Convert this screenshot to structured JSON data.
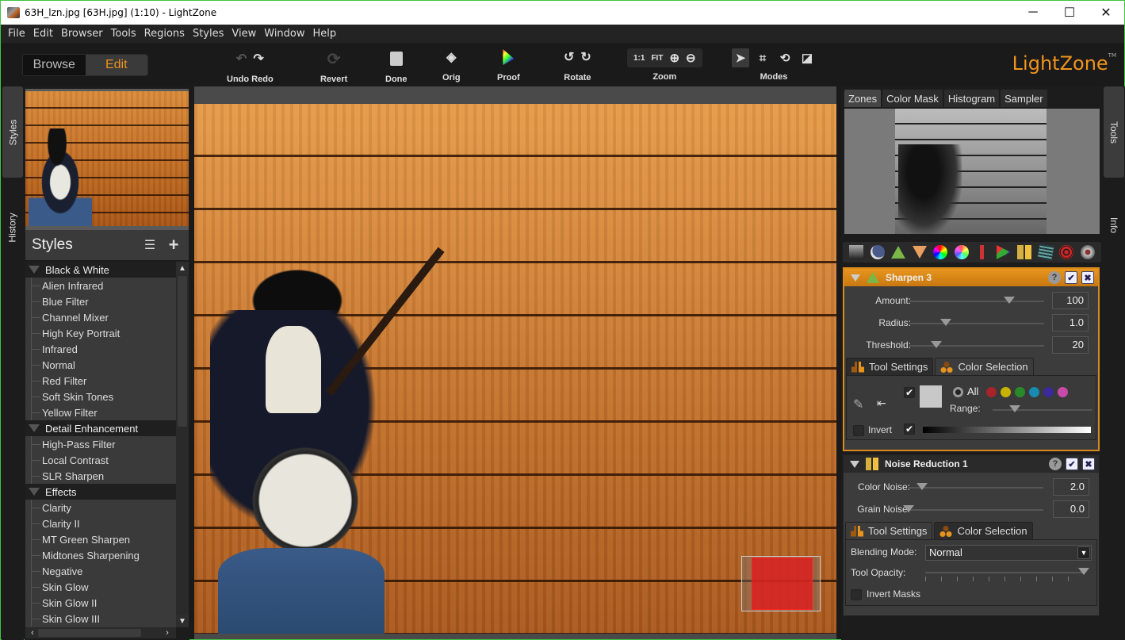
{
  "window": {
    "title": "63H_lzn.jpg [63H.jpg] (1:10) - LightZone",
    "controls": {
      "minimize": "─",
      "maximize": "☐",
      "close": "✕"
    }
  },
  "menu": [
    "File",
    "Edit",
    "Browser",
    "Tools",
    "Regions",
    "Styles",
    "View",
    "Window",
    "Help"
  ],
  "toolbar": {
    "mode_browse": "Browse",
    "mode_edit": "Edit",
    "undo_redo_label": "Undo Redo",
    "revert_label": "Revert",
    "done_label": "Done",
    "orig_label": "Orig",
    "proof_label": "Proof",
    "rotate_label": "Rotate",
    "zoom_label": "Zoom",
    "zoom_1to1": "1:1",
    "zoom_fit": "FIT",
    "modes_label": "Modes",
    "logo": "LightZone",
    "logo_tm": "TM",
    "accent_color": "#f0941c"
  },
  "left_tabs": {
    "styles": "Styles",
    "history": "History"
  },
  "styles_panel": {
    "title": "Styles",
    "categories": [
      {
        "name": "Black & White",
        "items": [
          "Alien Infrared",
          "Blue Filter",
          "Channel Mixer",
          "High Key Portrait",
          "Infrared",
          "Normal",
          "Red Filter",
          "Soft Skin Tones",
          "Yellow Filter"
        ]
      },
      {
        "name": "Detail Enhancement",
        "items": [
          "High-Pass Filter",
          "Local Contrast",
          "SLR Sharpen"
        ]
      },
      {
        "name": "Effects",
        "items": [
          "Clarity",
          "Clarity II",
          "MT Green Sharpen",
          "Midtones Sharpening",
          "Negative",
          "Skin Glow",
          "Skin Glow II",
          "Skin Glow III"
        ]
      }
    ]
  },
  "right_panel": {
    "tabs": [
      "Zones",
      "Color Mask",
      "Histogram",
      "Sampler"
    ],
    "active_tab": "Zones",
    "tool_icons": [
      "zone-mapper-icon",
      "relight-icon",
      "sharpen-icon",
      "blur-icon",
      "hue-saturation-icon",
      "color-balance-icon",
      "white-balance-icon",
      "tone-curve-icon",
      "noise-reduction-icon",
      "clone-icon",
      "spot-icon",
      "red-eye-icon"
    ],
    "sharpen": {
      "title": "Sharpen 3",
      "sliders": [
        {
          "label": "Amount:",
          "value": "100",
          "position": 0.74
        },
        {
          "label": "Radius:",
          "value": "1.0",
          "position": 0.27
        },
        {
          "label": "Threshold:",
          "value": "20",
          "position": 0.2
        }
      ],
      "tab_tool_settings": "Tool Settings",
      "tab_color_selection": "Color Selection",
      "active_subtab": "Color Selection",
      "color_all": "All",
      "range_label": "Range:",
      "range_position": 0.22,
      "invert_label": "Invert",
      "invert_checked": false,
      "color_enabled": true,
      "lum_enabled": true,
      "swatches": [
        "#a8232a",
        "#c8b400",
        "#2a8a2a",
        "#1a8ab0",
        "#3a2a9a",
        "#c84aa8"
      ]
    },
    "noise": {
      "title": "Noise Reduction 1",
      "sliders": [
        {
          "label": "Color Noise:",
          "value": "2.0",
          "position": 0.1
        },
        {
          "label": "Grain Noise:",
          "value": "0.0",
          "position": 0.0
        }
      ],
      "tab_tool_settings": "Tool Settings",
      "tab_color_selection": "Color Selection",
      "active_subtab": "Tool Settings",
      "blending_label": "Blending Mode:",
      "blending_value": "Normal",
      "opacity_label": "Tool Opacity:",
      "opacity": 1.0,
      "invert_masks_label": "Invert Masks",
      "invert_masks_checked": false
    }
  },
  "right_tabs": {
    "tools": "Tools",
    "info": "Info"
  }
}
